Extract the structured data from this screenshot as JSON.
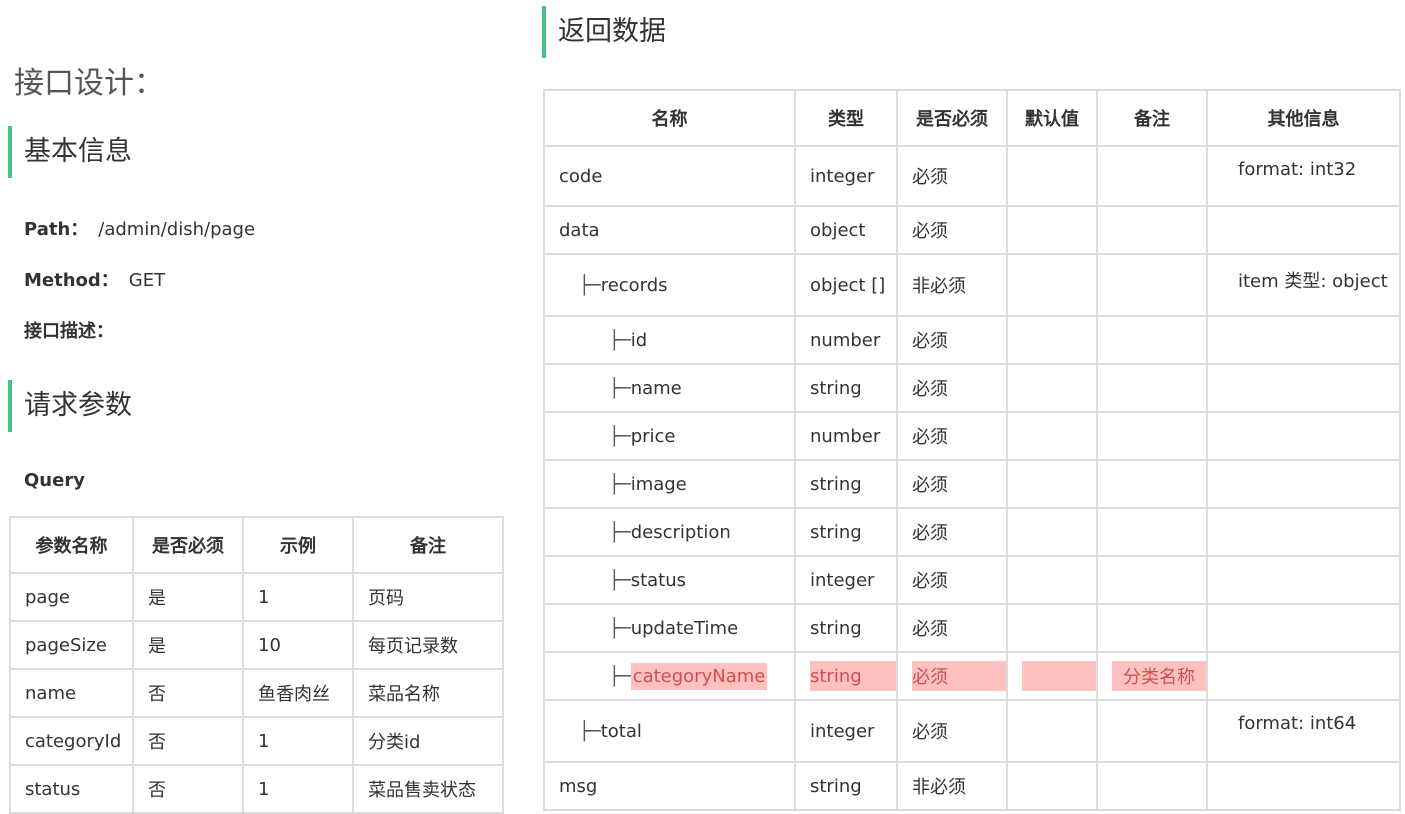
{
  "page_title": "接口设计：",
  "basic_info": {
    "heading": "基本信息",
    "path_label": "Path：",
    "path_value": "/admin/dish/page",
    "method_label": "Method：",
    "method_value": "GET",
    "desc_label": "接口描述："
  },
  "request_params": {
    "heading": "请求参数",
    "query_label": "Query",
    "columns": [
      "参数名称",
      "是否必须",
      "示例",
      "备注"
    ],
    "rows": [
      [
        "page",
        "是",
        "1",
        "页码"
      ],
      [
        "pageSize",
        "是",
        "10",
        "每页记录数"
      ],
      [
        "name",
        "否",
        "鱼香肉丝",
        "菜品名称"
      ],
      [
        "categoryId",
        "否",
        "1",
        "分类id"
      ],
      [
        "status",
        "否",
        "1",
        "菜品售卖状态"
      ]
    ]
  },
  "response": {
    "heading": "返回数据",
    "columns": [
      "名称",
      "类型",
      "是否必须",
      "默认值",
      "备注",
      "其他信息"
    ],
    "tree_prefix": "├─",
    "rows": [
      {
        "name": "code",
        "type": "integer",
        "required": "必须",
        "default": "",
        "remark": "",
        "extra": "format: int32"
      },
      {
        "name": "data",
        "type": "object",
        "required": "必须",
        "default": "",
        "remark": "",
        "extra": ""
      },
      {
        "name": "records",
        "type": "object []",
        "required": "非必须",
        "default": "",
        "remark": "",
        "extra": "item 类型: object"
      },
      {
        "name": "id",
        "type": "number",
        "required": "必须",
        "default": "",
        "remark": "",
        "extra": ""
      },
      {
        "name": "name",
        "type": "string",
        "required": "必须",
        "default": "",
        "remark": "",
        "extra": ""
      },
      {
        "name": "price",
        "type": "number",
        "required": "必须",
        "default": "",
        "remark": "",
        "extra": ""
      },
      {
        "name": "image",
        "type": "string",
        "required": "必须",
        "default": "",
        "remark": "",
        "extra": ""
      },
      {
        "name": "description",
        "type": "string",
        "required": "必须",
        "default": "",
        "remark": "",
        "extra": ""
      },
      {
        "name": "status",
        "type": "integer",
        "required": "必须",
        "default": "",
        "remark": "",
        "extra": ""
      },
      {
        "name": "updateTime",
        "type": "string",
        "required": "必须",
        "default": "",
        "remark": "",
        "extra": ""
      },
      {
        "name": "categoryName",
        "type": "string",
        "required": "必须",
        "default": "",
        "remark": "分类名称",
        "extra": ""
      },
      {
        "name": "total",
        "type": "integer",
        "required": "必须",
        "default": "",
        "remark": "",
        "extra": "format: int64"
      },
      {
        "name": "msg",
        "type": "string",
        "required": "非必须",
        "default": "",
        "remark": "",
        "extra": ""
      }
    ]
  },
  "colors": {
    "accent": "#42c38a",
    "border": "#dcdcdc",
    "highlight_bg": "#ffc0c0",
    "highlight_text": "#d05050"
  }
}
